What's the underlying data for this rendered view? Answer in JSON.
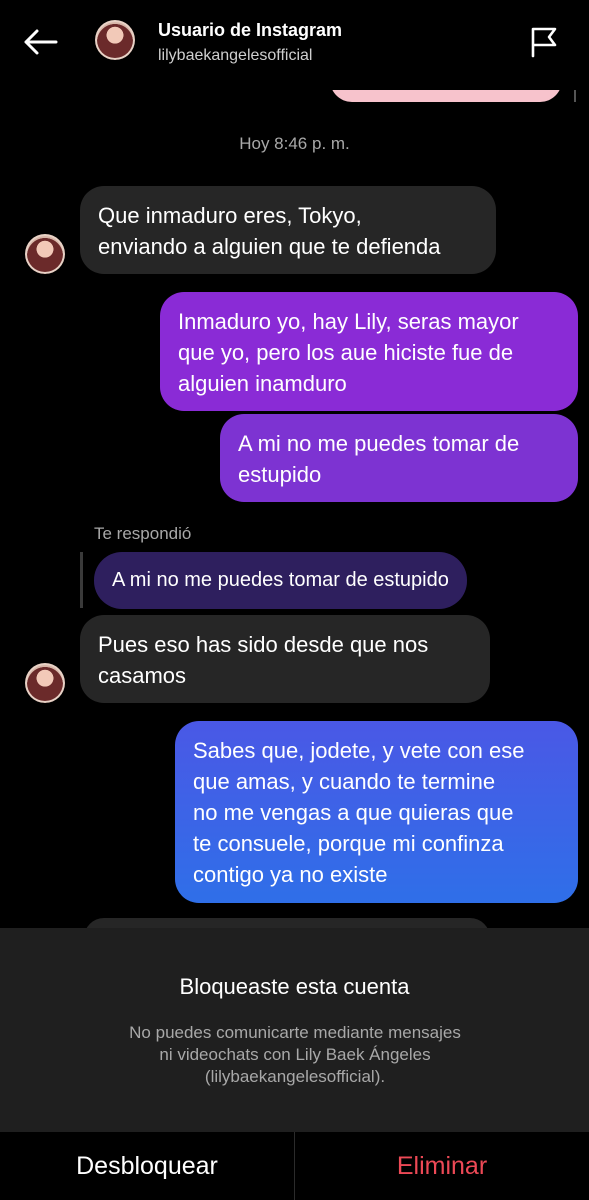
{
  "header": {
    "title": "Usuario de Instagram",
    "username": "lilybaekangelesofficial"
  },
  "chat": {
    "timestamp": "Hoy 8:46 p. m.",
    "messages": [
      {
        "from": "them",
        "lines": [
          "Que inmaduro eres, Tokyo,",
          "enviando a alguien que te defienda"
        ]
      },
      {
        "from": "me",
        "lines": [
          "Inmaduro yo, hay Lily, seras mayor",
          "que yo, pero los aue hiciste fue de",
          "alguien inamduro"
        ]
      },
      {
        "from": "me",
        "lines": [
          "A mi no me puedes tomar de",
          "estupido"
        ]
      },
      {
        "from": "them",
        "lines": [
          "Pues eso has sido desde que nos",
          "casamos"
        ]
      },
      {
        "from": "me",
        "lines": [
          "Sabes que, jodete, y vete con ese",
          "que amas, y cuando te termine",
          "no me vengas a que quieras que",
          "te consuele, porque mi confinza",
          "contigo ya no existe"
        ]
      }
    ],
    "reply": {
      "label": "Te respondió",
      "quoted_text": "A mi no me puedes tomar de estupido"
    }
  },
  "blocked": {
    "title": "Bloqueaste esta cuenta",
    "description_lines": [
      "No puedes comunicarte mediante mensajes",
      "ni videochats con Lily Baek Ángeles",
      "(lilybaekangelesofficial)."
    ]
  },
  "actions": {
    "unblock": "Desbloquear",
    "delete": "Eliminar"
  },
  "colors": {
    "background": "#000000",
    "received_bubble": "#262626",
    "sent_gradient_top": "#8a2bd6",
    "sent_gradient_bottom": "#2f6fe8",
    "delete_red": "#ed4956"
  }
}
